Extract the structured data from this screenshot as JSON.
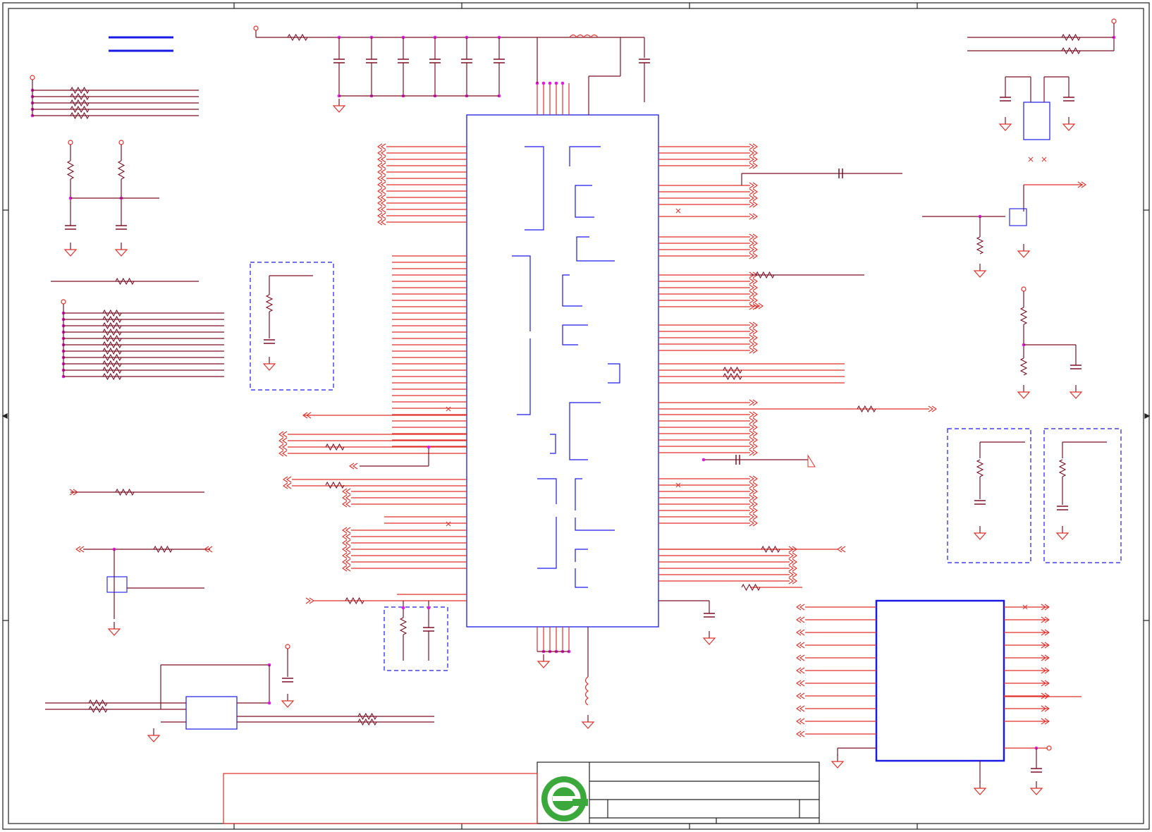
{
  "title_block": {
    "logo_icon": "company-logo-circle-e"
  },
  "colors": {
    "wire": "#7a1026",
    "pin": "#e0302a",
    "part": "#1a1ae6",
    "junction": "#e01ae0",
    "frame": "#222222",
    "logo_green": "#3aa83a"
  }
}
